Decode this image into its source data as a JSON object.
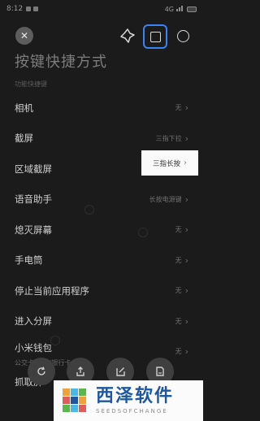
{
  "status_bar": {
    "time": "8:12",
    "network": "4G"
  },
  "toolbar": {
    "close_symbol": "✕"
  },
  "page": {
    "title": "按键快捷方式",
    "section_label": "功能快捷键"
  },
  "rows": [
    {
      "label": "相机",
      "value": "无",
      "sub": ""
    },
    {
      "label": "截屏",
      "value": "三指下拉",
      "sub": ""
    },
    {
      "label": "区域截屏",
      "value": "",
      "sub": ""
    },
    {
      "label": "语音助手",
      "value": "长按电源键",
      "sub": ""
    },
    {
      "label": "熄灭屏幕",
      "value": "无",
      "sub": ""
    },
    {
      "label": "手电筒",
      "value": "无",
      "sub": ""
    },
    {
      "label": "停止当前应用程序",
      "value": "无",
      "sub": ""
    },
    {
      "label": "进入分屏",
      "value": "无",
      "sub": ""
    },
    {
      "label": "小米钱包",
      "value": "无",
      "sub": "公交卡/门卡/银行卡"
    },
    {
      "label": "抓取屏",
      "value": "",
      "sub": ""
    }
  ],
  "highlight": {
    "text": "三指长按"
  },
  "chevron": "›",
  "watermark": {
    "cn": "西泽软件",
    "en": "SEEDSOFCHANGE"
  },
  "colors": {
    "accent": "#3b82f6",
    "brand_blue": "#1e56a0"
  }
}
